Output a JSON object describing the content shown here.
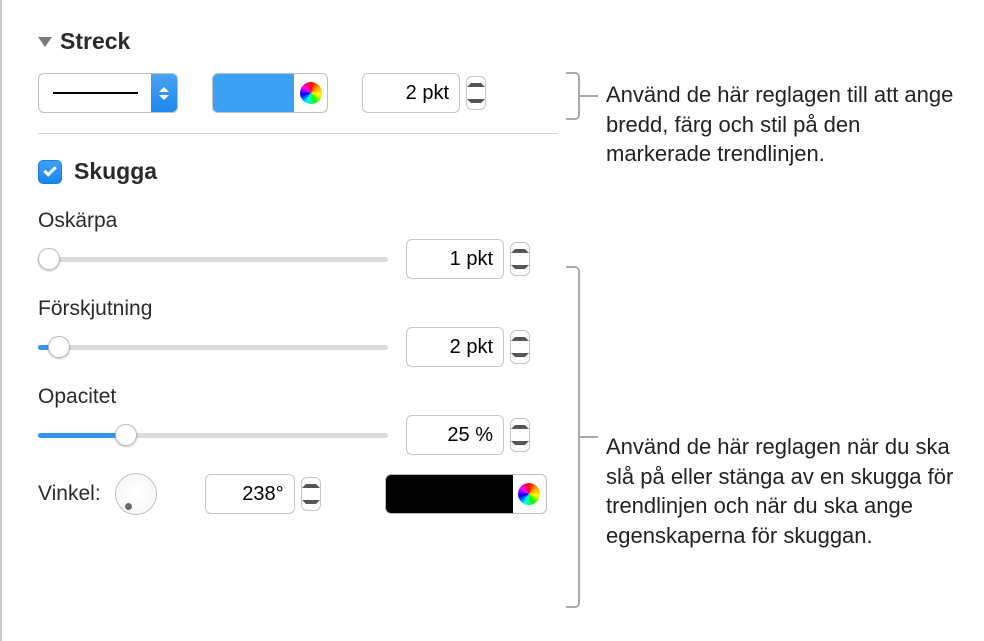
{
  "stroke": {
    "title": "Streck",
    "width_value": "2 pkt"
  },
  "shadow": {
    "title": "Skugga",
    "checked": true,
    "blur": {
      "label": "Oskärpa",
      "value": "1 pkt",
      "percent": 3
    },
    "offset": {
      "label": "Förskjutning",
      "value": "2 pkt",
      "percent": 6
    },
    "opacity": {
      "label": "Opacitet",
      "value": "25 %",
      "percent": 25
    },
    "angle": {
      "label": "Vinkel:",
      "value": "238°"
    }
  },
  "colors": {
    "stroke_swatch": "#3ba1f4",
    "shadow_swatch": "#000000"
  },
  "callouts": {
    "top": "Använd de här reglagen till att ange bredd, färg och stil på den markerade trendlinjen.",
    "bottom": "Använd de här reglagen när du ska slå på eller stänga av en skugga för trendlinjen och när du ska ange egenskaperna för skuggan."
  }
}
